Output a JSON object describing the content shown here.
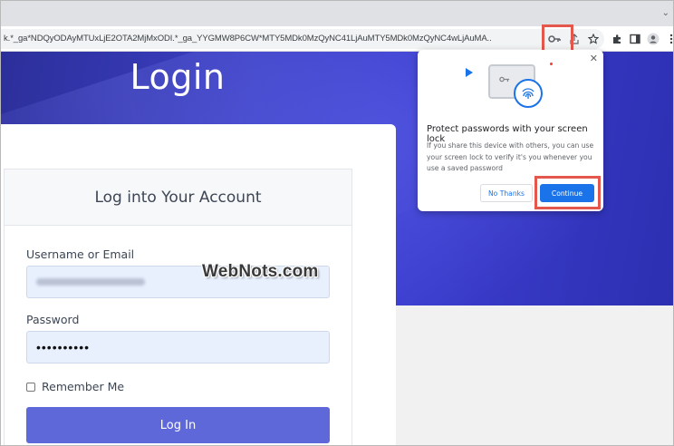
{
  "browser": {
    "url": "k.*_ga*NDQyODAyMTUxLjE2OTA2MjMxODI.*_ga_YYGMW8P6CW*MTY5MDk0MzQyNC41LjAuMTY5MDk0MzQyNC4wLjAuMA..",
    "icons": [
      "key-icon",
      "share-icon",
      "star-icon",
      "extensions-icon",
      "sidepanel-icon",
      "profile-icon",
      "menu-icon"
    ]
  },
  "page": {
    "hero_title": "Login",
    "card_title": "Log into Your Account",
    "username_label": "Username or Email",
    "password_label": "Password",
    "password_value": "••••••••••",
    "remember_label": "Remember Me",
    "login_button": "Log In"
  },
  "popup": {
    "title": "Protect passwords with your screen lock",
    "body": "If you share this device with others, you can use your screen lock to verify it's you whenever you use a saved password",
    "no_thanks": "No Thanks",
    "continue": "Continue"
  },
  "watermark": "WebNots.com",
  "colors": {
    "hero": "#3b3fc2",
    "login_button": "#5f68d8",
    "accent": "#1a73e8",
    "highlight": "#e3574c"
  }
}
